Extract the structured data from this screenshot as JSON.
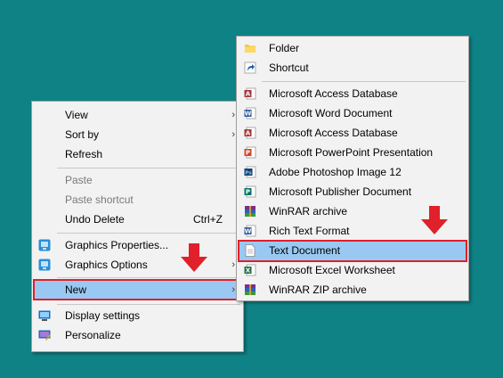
{
  "context_menu": {
    "view": "View",
    "sort_by": "Sort by",
    "refresh": "Refresh",
    "paste": "Paste",
    "paste_shortcut": "Paste shortcut",
    "undo_delete": "Undo Delete",
    "undo_delete_shortcut": "Ctrl+Z",
    "graphics_properties": "Graphics Properties...",
    "graphics_options": "Graphics Options",
    "new": "New",
    "display_settings": "Display settings",
    "personalize": "Personalize",
    "submenu_arrow": "›"
  },
  "new_submenu": {
    "items": [
      {
        "label": "Folder",
        "icon": "folder-icon"
      },
      {
        "label": "Shortcut",
        "icon": "shortcut-icon"
      },
      {
        "label": "Microsoft Access Database",
        "icon": "access-icon"
      },
      {
        "label": "Microsoft Word Document",
        "icon": "word-icon"
      },
      {
        "label": "Microsoft Access Database",
        "icon": "access-icon"
      },
      {
        "label": "Microsoft PowerPoint Presentation",
        "icon": "powerpoint-icon"
      },
      {
        "label": "Adobe Photoshop Image 12",
        "icon": "photoshop-icon"
      },
      {
        "label": "Microsoft Publisher Document",
        "icon": "publisher-icon"
      },
      {
        "label": "WinRAR archive",
        "icon": "winrar-icon"
      },
      {
        "label": "Rich Text Format",
        "icon": "rtf-icon"
      },
      {
        "label": "Text Document",
        "icon": "text-document-icon"
      },
      {
        "label": "Microsoft Excel Worksheet",
        "icon": "excel-icon"
      },
      {
        "label": "WinRAR ZIP archive",
        "icon": "winrar-zip-icon"
      }
    ]
  },
  "icon_glyphs": {
    "word": "W",
    "access": "A",
    "powerpoint": "P",
    "photoshop": "Ps",
    "publisher": "P",
    "excel": "X"
  },
  "colors": {
    "desktop_background": "#0f8286",
    "menu_background": "#f2f2f2",
    "highlight": "#99c9f2",
    "annotation_red": "#e0202a"
  }
}
